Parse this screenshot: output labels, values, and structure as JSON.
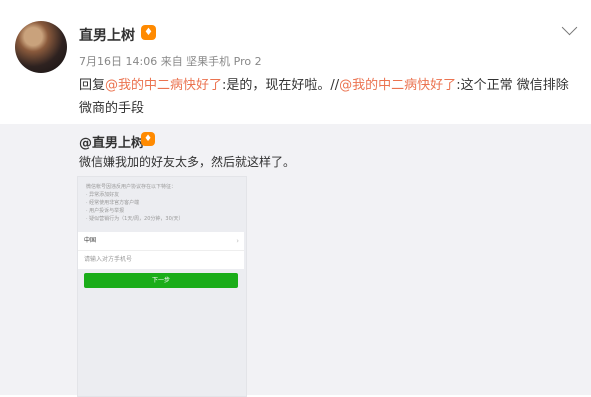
{
  "post": {
    "author": "直男上树",
    "badge": "vip",
    "meta": "7月16日 14:06 来自 坚果手机 Pro 2",
    "text_reply": "回复",
    "mention_1": "@我的中二病快好了",
    "text_1": ":是的，现在好啦。//",
    "mention_2": "@我的中二病快好了",
    "text_2": ":这个正常 微信排除微商的手段"
  },
  "repost": {
    "author": "@直男上树",
    "text": "微信嫌我加的好友太多，然后就这样了。",
    "image": {
      "notice": "微信帐号因违反用户协议存在以下特征：\n· 异常添加好友\n· 经常使用非官方客户端\n· 用户投诉与举报\n· 疑似营销行为（1天/周，20分钟，30/天）",
      "country": "中国",
      "phone_placeholder": "请输入对方手机号",
      "button": "下一步"
    }
  },
  "colors": {
    "mention": "#eb7350",
    "badge": "#ff8a00",
    "wechat_green": "#1aad19"
  },
  "icons": [
    "avatar",
    "vip-badge-icon",
    "chevron-down-icon"
  ]
}
